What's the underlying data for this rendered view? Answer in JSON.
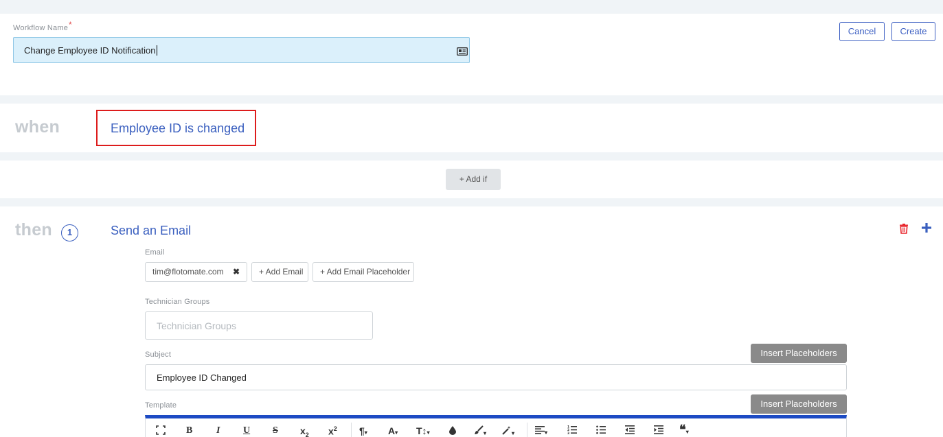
{
  "workflow": {
    "name_label": "Workflow Name",
    "required_mark": "*",
    "name_value": "Change Employee ID Notification",
    "cancel_label": "Cancel",
    "create_label": "Create"
  },
  "when": {
    "keyword": "when",
    "trigger": "Employee ID is changed"
  },
  "add_if_label": "+ Add if",
  "then": {
    "keyword": "then",
    "step_number": "1",
    "action_title": "Send an Email",
    "email_label": "Email",
    "email_chips": [
      "tim@flotomate.com"
    ],
    "add_email_label": "+ Add Email",
    "add_email_placeholder_label": "+ Add Email Placeholder",
    "tech_groups_label": "Technician Groups",
    "tech_groups_placeholder": "Technician Groups",
    "subject_label": "Subject",
    "subject_value": "Employee ID Changed",
    "template_label": "Template",
    "insert_placeholders_label": "Insert Placeholders"
  },
  "toolbar_icons": [
    "fullscreen-icon",
    "bold-icon",
    "italic-icon",
    "underline-icon",
    "strikethrough-icon",
    "subscript-icon",
    "superscript-icon",
    "paragraph-format-icon",
    "font-color-icon",
    "font-size-icon",
    "paint-color-icon",
    "brush-icon",
    "magic-wand-icon",
    "align-icon",
    "ordered-list-icon",
    "unordered-list-icon",
    "outdent-icon",
    "indent-icon",
    "quote-icon"
  ],
  "colors": {
    "accent": "#3a5fbf",
    "highlight_border": "#dd1c1c",
    "toolbar_bar": "#1d4bc4",
    "delete": "#e8232a"
  }
}
